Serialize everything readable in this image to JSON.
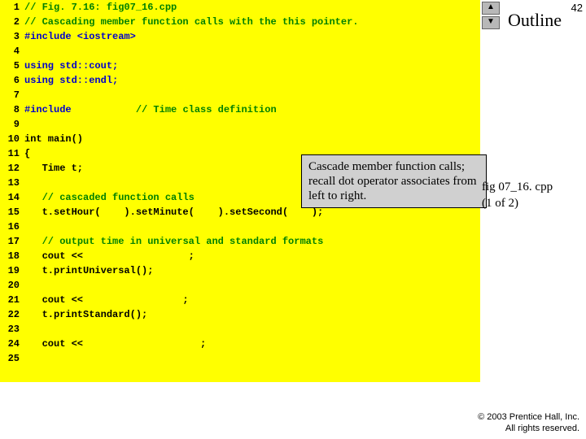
{
  "sidebar": {
    "outline": "Outline",
    "page_num": "42",
    "file_label": "fig 07_16. cpp",
    "part_label": "(1 of 2)",
    "nav_up": "▲",
    "nav_down": "▼"
  },
  "callout": "Cascade member function calls; recall dot operator associates from left to right.",
  "copyright": {
    "line1": "© 2003 Prentice Hall, Inc.",
    "line2": "All rights reserved."
  },
  "code": [
    {
      "n": "1",
      "segs": [
        {
          "cls": "c-comment",
          "t": "// Fig. 7.16: fig07_16.cpp"
        }
      ]
    },
    {
      "n": "2",
      "segs": [
        {
          "cls": "c-comment",
          "t": "// Cascading member function calls with the this pointer."
        }
      ]
    },
    {
      "n": "3",
      "segs": [
        {
          "cls": "c-pre",
          "t": "#include <iostream>"
        }
      ]
    },
    {
      "n": "4",
      "segs": []
    },
    {
      "n": "5",
      "segs": [
        {
          "cls": "c-pre",
          "t": "using std::cout;"
        }
      ]
    },
    {
      "n": "6",
      "segs": [
        {
          "cls": "c-pre",
          "t": "using std::endl;"
        }
      ]
    },
    {
      "n": "7",
      "segs": []
    },
    {
      "n": "8",
      "segs": [
        {
          "cls": "c-pre",
          "t": "#include           "
        },
        {
          "cls": "c-comment",
          "t": "// Time class definition"
        }
      ]
    },
    {
      "n": "9",
      "segs": []
    },
    {
      "n": "10",
      "segs": [
        {
          "cls": "",
          "t": "int main()"
        }
      ]
    },
    {
      "n": "11",
      "segs": [
        {
          "cls": "",
          "t": "{"
        }
      ]
    },
    {
      "n": "12",
      "segs": [
        {
          "cls": "",
          "t": "   Time t;"
        }
      ]
    },
    {
      "n": "13",
      "segs": []
    },
    {
      "n": "14",
      "segs": [
        {
          "cls": "",
          "t": "   "
        },
        {
          "cls": "c-comment",
          "t": "// cascaded function calls"
        }
      ]
    },
    {
      "n": "15",
      "segs": [
        {
          "cls": "",
          "t": "   t.setHour(    ).setMinute(    ).setSecond(    );"
        }
      ]
    },
    {
      "n": "16",
      "segs": []
    },
    {
      "n": "17",
      "segs": [
        {
          "cls": "",
          "t": "   "
        },
        {
          "cls": "c-comment",
          "t": "// output time in universal and standard formats"
        }
      ]
    },
    {
      "n": "18",
      "segs": [
        {
          "cls": "",
          "t": "   cout <<                  ;"
        }
      ]
    },
    {
      "n": "19",
      "segs": [
        {
          "cls": "",
          "t": "   t.printUniversal();"
        }
      ]
    },
    {
      "n": "20",
      "segs": []
    },
    {
      "n": "21",
      "segs": [
        {
          "cls": "",
          "t": "   cout <<                 ;"
        }
      ]
    },
    {
      "n": "22",
      "segs": [
        {
          "cls": "",
          "t": "   t.printStandard();"
        }
      ]
    },
    {
      "n": "23",
      "segs": []
    },
    {
      "n": "24",
      "segs": [
        {
          "cls": "",
          "t": "   cout <<                    ;"
        }
      ]
    },
    {
      "n": "25",
      "segs": []
    }
  ]
}
